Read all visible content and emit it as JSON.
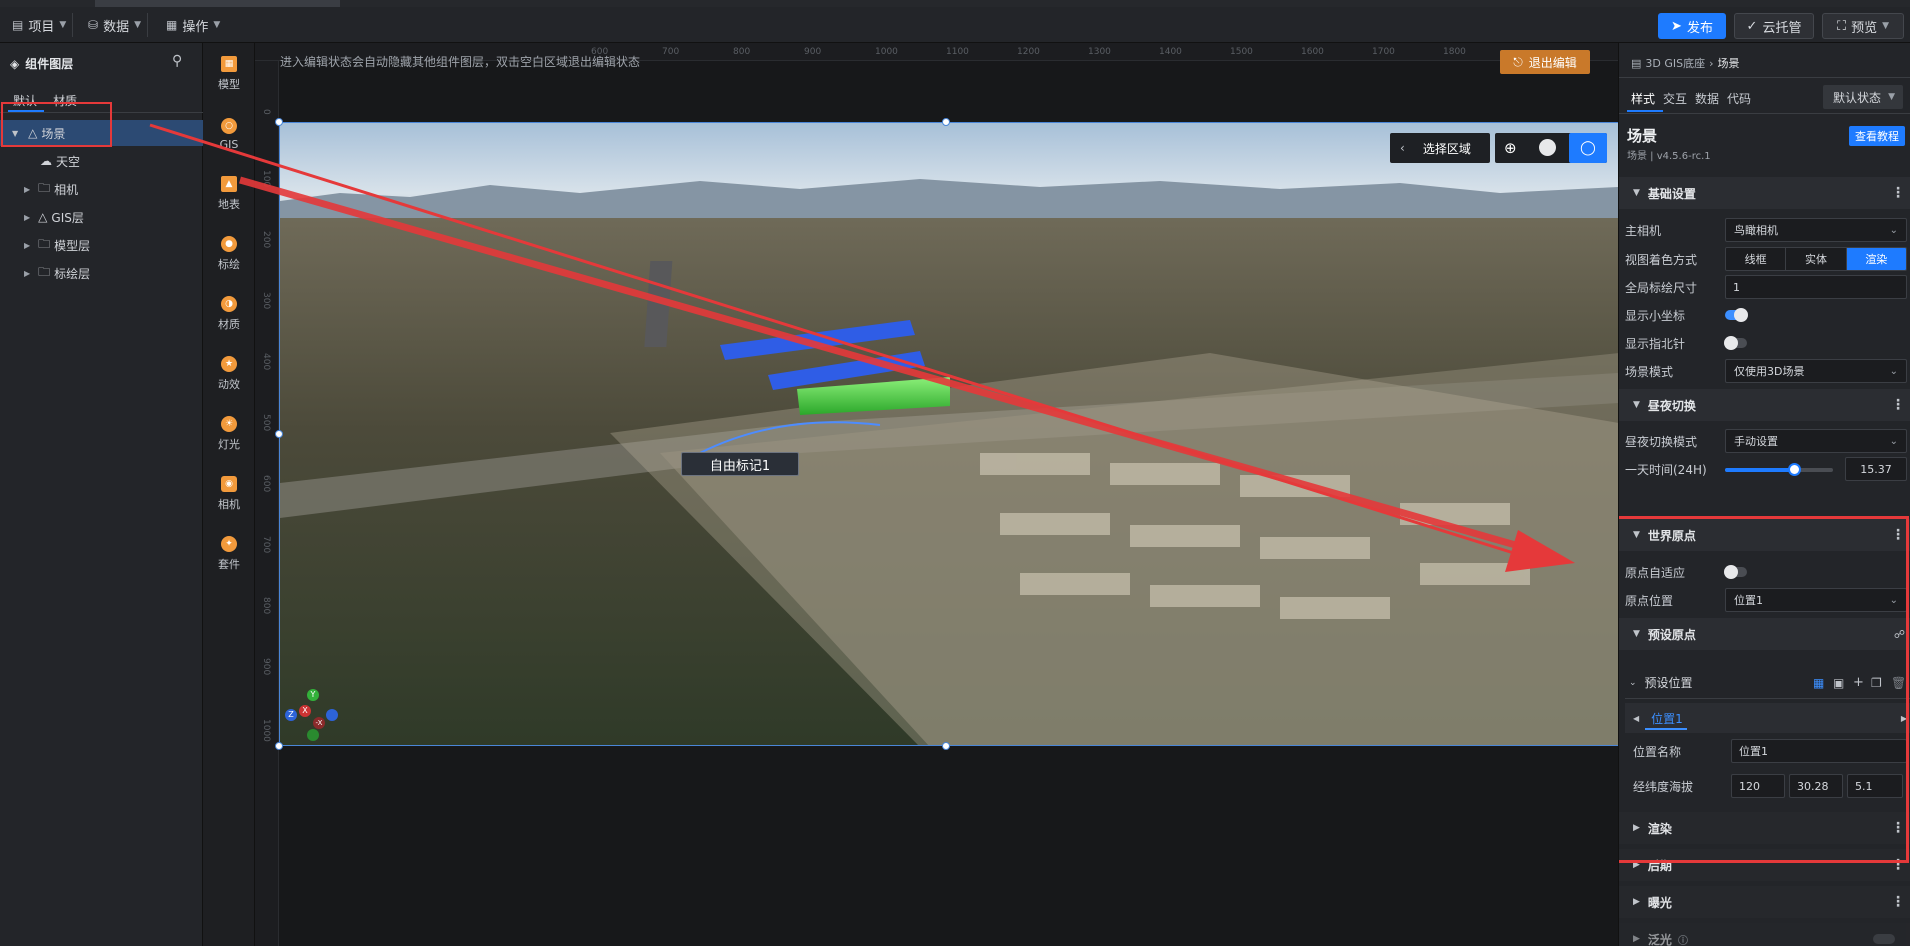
{
  "topbar": {
    "menus": [
      {
        "label": "项目",
        "icon": "file-icon"
      },
      {
        "label": "数据",
        "icon": "database-icon"
      },
      {
        "label": "操作",
        "icon": "grid-icon"
      }
    ],
    "publish_label": "发布",
    "cloud_label": "云托管",
    "preview_label": "预览"
  },
  "left_panel": {
    "title": "组件图层",
    "tabs": [
      "默认",
      "材质"
    ],
    "tree": [
      {
        "label": "场景",
        "level": 0,
        "icon": "scene-icon",
        "selected": true
      },
      {
        "label": "天空",
        "level": 1,
        "icon": "sky-icon"
      },
      {
        "label": "相机",
        "level": 1,
        "icon": "folder-icon"
      },
      {
        "label": "GIS层",
        "level": 1,
        "icon": "gis-icon"
      },
      {
        "label": "模型层",
        "level": 1,
        "icon": "folder-icon"
      },
      {
        "label": "标绘层",
        "level": 1,
        "icon": "folder-icon"
      }
    ]
  },
  "icon_bar": [
    {
      "label": "模型",
      "icon": "model-icon"
    },
    {
      "label": "GIS",
      "icon": "gis-globe-icon"
    },
    {
      "label": "地表",
      "icon": "terrain-icon"
    },
    {
      "label": "标绘",
      "icon": "pin-icon"
    },
    {
      "label": "材质",
      "icon": "material-icon"
    },
    {
      "label": "动效",
      "icon": "effect-icon"
    },
    {
      "label": "灯光",
      "icon": "light-icon"
    },
    {
      "label": "相机",
      "icon": "camera-icon"
    },
    {
      "label": "套件",
      "icon": "kit-icon"
    }
  ],
  "canvas": {
    "hint": "进入编辑状态会自动隐藏其他组件图层，双击空白区域退出编辑状态",
    "exit_edit_label": "退出编辑",
    "select_region_label": "选择区域",
    "marker_label": "自由标记1",
    "ruler_top": [
      "600",
      "700",
      "800",
      "900",
      "1000",
      "1100",
      "1200",
      "1300",
      "1400",
      "1500",
      "1600",
      "1700",
      "1800"
    ],
    "ruler_left": [
      "0",
      "100",
      "200",
      "300",
      "400",
      "500",
      "600",
      "700",
      "800",
      "900",
      "1000"
    ],
    "axis_labels": {
      "y": "Y",
      "x": "X",
      "negx": "-X",
      "z": "Z"
    }
  },
  "right_panel": {
    "breadcrumb_root": "3D GIS底座",
    "breadcrumb_current": "场景",
    "tabs": [
      "样式",
      "交互",
      "数据",
      "代码"
    ],
    "state_select": "默认状态",
    "component_title": "场景",
    "component_version": "场景 | v4.5.6-rc.1",
    "tutorial_label": "查看教程",
    "sections": {
      "basic": "基础设置",
      "daynight": "昼夜切换",
      "world_origin": "世界原点",
      "preset_origin": "预设原点",
      "render": "渲染",
      "post": "后期",
      "exposure": "曝光",
      "bloom": "泛光"
    },
    "fields": {
      "main_camera_label": "主相机",
      "main_camera_value": "鸟瞰相机",
      "shading_label": "视图着色方式",
      "shading_options": [
        "线框",
        "实体",
        "渲染"
      ],
      "global_scale_label": "全局标绘尺寸",
      "global_scale_value": "1",
      "show_axis_label": "显示小坐标",
      "show_compass_label": "显示指北针",
      "scene_mode_label": "场景模式",
      "scene_mode_value": "仅使用3D场景",
      "daynight_mode_label": "昼夜切换模式",
      "daynight_mode_value": "手动设置",
      "time_label": "一天时间(24H)",
      "time_value": "15.37",
      "time_fraction": 0.64,
      "origin_adapt_label": "原点自适应",
      "origin_pos_label": "原点位置",
      "origin_pos_value": "位置1",
      "preset_pos_label": "预设位置",
      "preset_tab": "位置1",
      "pos_name_label": "位置名称",
      "pos_name_value": "位置1",
      "lonlat_label": "经纬度海拔",
      "lon": "120",
      "lat": "30.28",
      "alt": "5.1"
    }
  },
  "colors": {
    "accent": "#1e7bff",
    "highlight_red": "#e5393a",
    "exit_btn": "#c9792a",
    "toggle_on": "#3c8fff"
  }
}
